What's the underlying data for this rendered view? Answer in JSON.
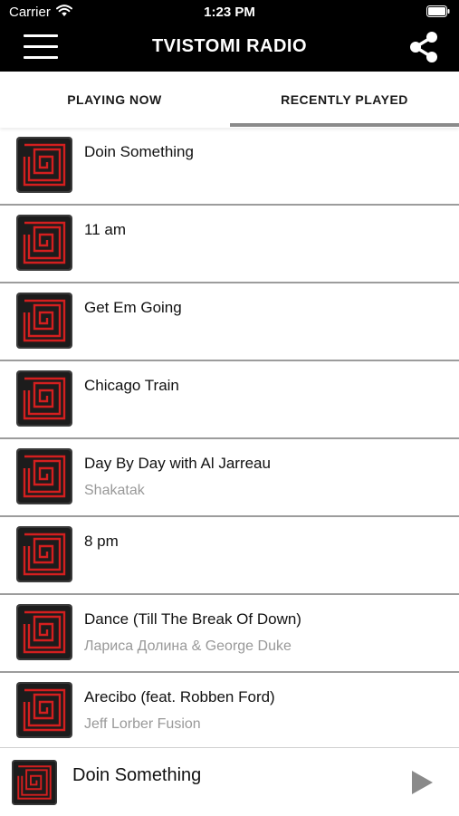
{
  "status_bar": {
    "carrier": "Carrier",
    "time": "1:23 PM",
    "wifi_icon": "wifi-icon",
    "battery_icon": "battery-icon"
  },
  "header": {
    "title": "TVISTOMI RADIO",
    "menu_icon": "hamburger-menu-icon",
    "share_icon": "share-icon",
    "background_color": "#000000"
  },
  "tabs": [
    {
      "label": "PLAYING NOW",
      "selected": false
    },
    {
      "label": "RECENTLY PLAYED",
      "selected": true
    }
  ],
  "colors": {
    "artwork_red": "#d41f1f",
    "artwork_bg": "#3a3a3a",
    "divider": "#9c9c9c",
    "secondary_text": "#999999"
  },
  "tracks": [
    {
      "title": "Doin Something",
      "artist": ""
    },
    {
      "title": "11 am",
      "artist": ""
    },
    {
      "title": "Get Em Going",
      "artist": ""
    },
    {
      "title": "Chicago Train",
      "artist": ""
    },
    {
      "title": "Day By Day with Al Jarreau",
      "artist": "Shakatak"
    },
    {
      "title": "8 pm",
      "artist": ""
    },
    {
      "title": "Dance (Till The Break Of Down)",
      "artist": "Лариса Долина & George Duke"
    },
    {
      "title": "Arecibo (feat. Robben Ford)",
      "artist": "Jeff Lorber Fusion"
    }
  ],
  "mini_player": {
    "title": "Doin Something",
    "play_icon": "play-icon"
  }
}
